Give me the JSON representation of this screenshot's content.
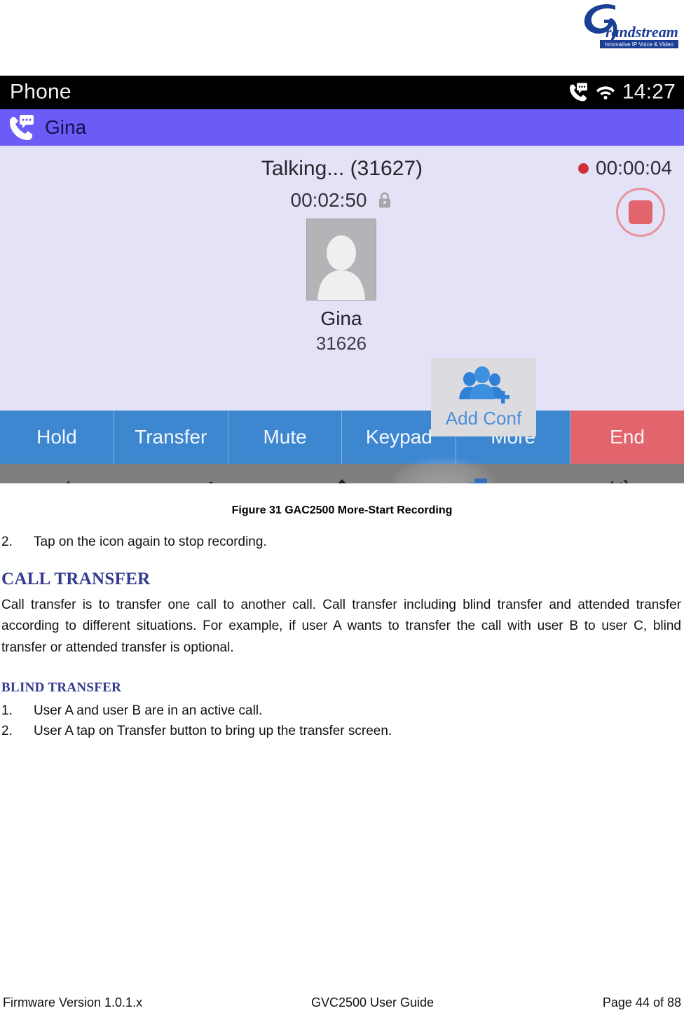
{
  "logo": {
    "wordmark": "randstream",
    "tagline": "Innovative IP Voice & Video",
    "brand_color": "#1b3f94"
  },
  "device": {
    "status_bar": {
      "title": "Phone",
      "clock": "14:27",
      "icons": [
        "missed-call-icon",
        "wifi-icon"
      ],
      "background": "#000000"
    },
    "call_bar": {
      "name": "Gina",
      "icon": "call-message-icon",
      "background": "#6b5cf7"
    },
    "call": {
      "state_line": "Talking... (31627)",
      "duration": "00:02:50",
      "secure_icon": "lock-icon",
      "participant": {
        "name": "Gina",
        "number": "31626",
        "avatar_icon": "person-avatar-icon"
      },
      "add_conf": {
        "label": "Add Conf",
        "icon": "add-people-icon",
        "color": "#4c8fd6"
      },
      "recording": {
        "elapsed": "00:00:04",
        "dot_color": "#d0303a",
        "stop_icon": "stop-recording-icon"
      },
      "background": "#e4e2f7"
    },
    "actions": [
      {
        "label": "Hold",
        "style": "primary"
      },
      {
        "label": "Transfer",
        "style": "primary"
      },
      {
        "label": "Mute",
        "style": "primary"
      },
      {
        "label": "Keypad",
        "style": "primary"
      },
      {
        "label": "More",
        "style": "primary"
      },
      {
        "label": "End",
        "style": "danger"
      }
    ],
    "action_colors": {
      "primary": "#3d86d0",
      "danger": "#e2646c"
    },
    "nav_items": [
      {
        "icon": "volume-down-icon"
      },
      {
        "icon": "back-icon"
      },
      {
        "icon": "home-icon"
      },
      {
        "icon": "recent-apps-icon"
      },
      {
        "icon": "volume-up-icon"
      }
    ],
    "nav_background": "#7e7e7e"
  },
  "document": {
    "figure_caption": "Figure 31 GAC2500 More-Start Recording",
    "step_stop_recording": {
      "num": "2.",
      "text": "Tap on the icon again to stop recording."
    },
    "heading_call_transfer": "CALL TRANSFER",
    "paragraph_call_transfer": "Call transfer is to transfer one call to another call. Call transfer including blind transfer and attended transfer according to different situations. For example, if user A wants to transfer the call with user B to user C, blind transfer or attended transfer is optional.",
    "heading_blind_transfer": "BLIND TRANSFER",
    "blind_steps": [
      {
        "num": "1.",
        "text": "User A and user B are in an active call."
      },
      {
        "num": "2.",
        "text": "User A tap on Transfer button to bring up the transfer screen."
      }
    ],
    "heading_color": "#343a8f"
  },
  "footer": {
    "left": "Firmware Version 1.0.1.x",
    "center": "GVC2500 User Guide",
    "right": "Page 44 of 88"
  }
}
